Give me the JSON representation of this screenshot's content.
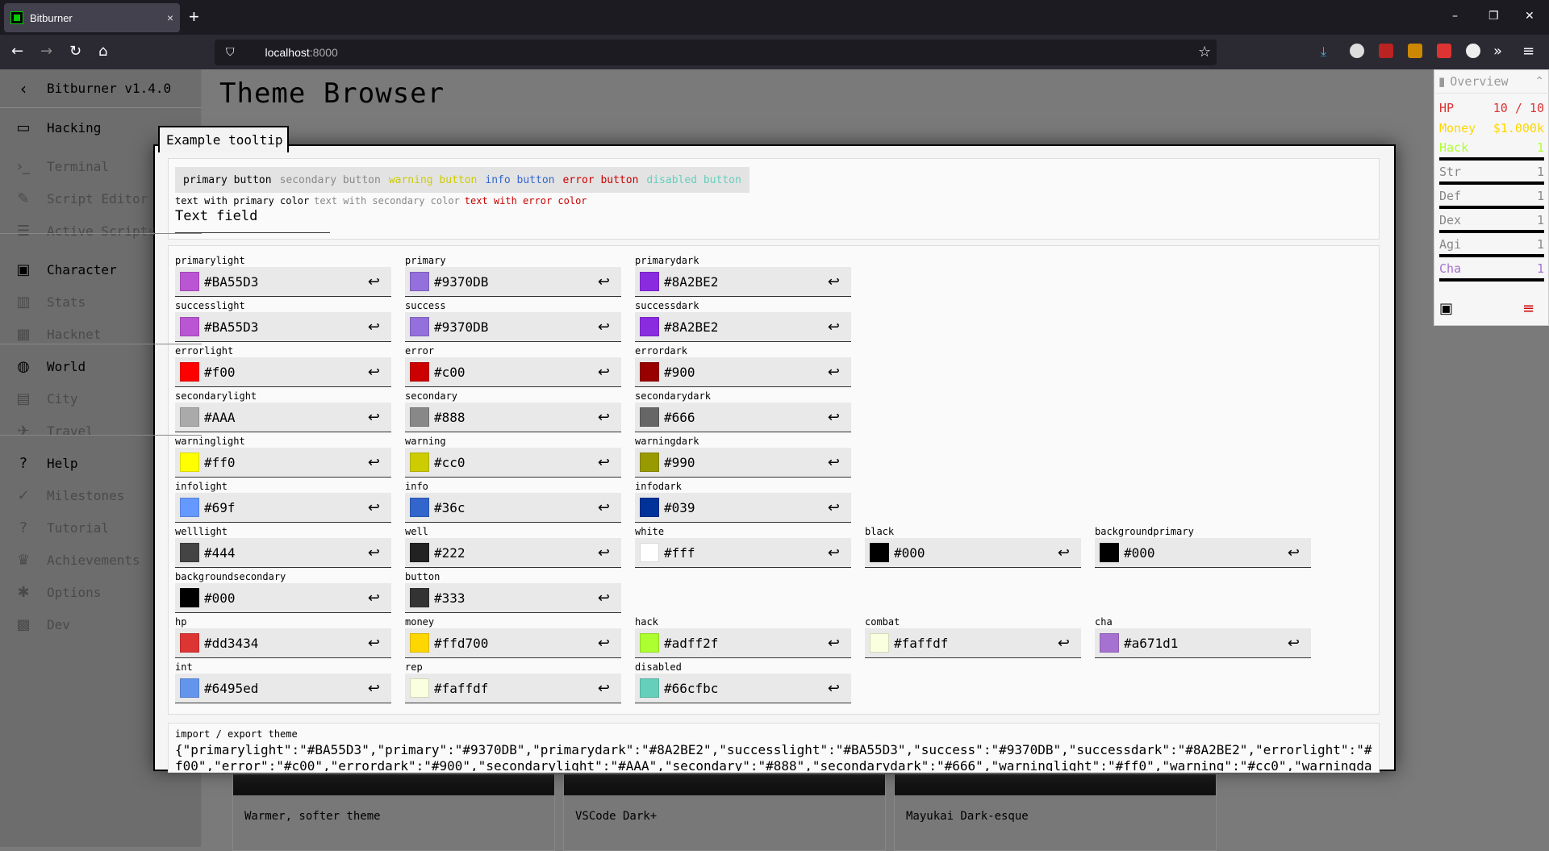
{
  "browser": {
    "tab_title": "Bitburner",
    "tab_close": "×",
    "new_tab": "+",
    "url_host": "localhost",
    "url_port": ":8000",
    "win_min": "–",
    "win_restore": "❐",
    "win_close": "✕",
    "nav_back": "←",
    "nav_forward": "→",
    "nav_reload": "↻",
    "nav_home": "⌂",
    "bookmark_star": "☆",
    "overflow": "»",
    "menu": "≡"
  },
  "sidebar": {
    "title": "Bitburner v1.4.0",
    "collapse": "‹",
    "items": [
      {
        "label": "Hacking",
        "kind": "main",
        "icon": "▭"
      },
      {
        "label": "Terminal",
        "kind": "sub",
        "icon": "›_"
      },
      {
        "label": "Script Editor",
        "kind": "sub",
        "icon": "✎"
      },
      {
        "label": "Active Scripts",
        "kind": "sub",
        "icon": "☰"
      },
      {
        "label": "Character",
        "kind": "main",
        "icon": "▣"
      },
      {
        "label": "Stats",
        "kind": "sub",
        "icon": "▥"
      },
      {
        "label": "Hacknet",
        "kind": "sub",
        "icon": "▦"
      },
      {
        "label": "World",
        "kind": "main",
        "icon": "◍"
      },
      {
        "label": "City",
        "kind": "sub",
        "icon": "▤"
      },
      {
        "label": "Travel",
        "kind": "sub",
        "icon": "✈"
      },
      {
        "label": "Help",
        "kind": "main",
        "icon": "?"
      },
      {
        "label": "Milestones",
        "kind": "sub",
        "icon": "✓"
      },
      {
        "label": "Tutorial",
        "kind": "sub",
        "icon": "?"
      },
      {
        "label": "Achievements",
        "kind": "sub",
        "icon": "♛"
      },
      {
        "label": "Options",
        "kind": "sub",
        "icon": "✱"
      },
      {
        "label": "Dev",
        "kind": "sub",
        "icon": "▩"
      }
    ]
  },
  "page": {
    "title": "Theme Browser",
    "cards": [
      "Warmer, softer theme",
      "VSCode Dark+",
      "Mayukai Dark-esque"
    ]
  },
  "overview": {
    "title": "Overview",
    "rows": [
      {
        "label": "HP",
        "value": "10 / 10",
        "color": "#dd3434",
        "bar": false
      },
      {
        "label": "Money",
        "value": "$1.000k",
        "color": "#ffd700",
        "bar": false
      },
      {
        "label": "Hack",
        "value": "1",
        "color": "#adff2f",
        "bar": true
      },
      {
        "label": "Str",
        "value": "1",
        "color": "#888888",
        "bar": true
      },
      {
        "label": "Def",
        "value": "1",
        "color": "#888888",
        "bar": true
      },
      {
        "label": "Dex",
        "value": "1",
        "color": "#888888",
        "bar": true
      },
      {
        "label": "Agi",
        "value": "1",
        "color": "#888888",
        "bar": true
      },
      {
        "label": "Cha",
        "value": "1",
        "color": "#a671d1",
        "bar": true
      }
    ]
  },
  "tooltip": "Example tooltip",
  "preview": {
    "buttons": [
      {
        "label": "primary button",
        "color": "#000000"
      },
      {
        "label": "secondary button",
        "color": "#888888"
      },
      {
        "label": "warning button",
        "color": "#cccc00"
      },
      {
        "label": "info button",
        "color": "#3366cc"
      },
      {
        "label": "error button",
        "color": "#cc0000"
      },
      {
        "label": "disabled button",
        "color": "#66cfbc"
      }
    ],
    "texts": [
      {
        "label": "text with primary color",
        "color": "#000000"
      },
      {
        "label": "text with secondary color",
        "color": "#888888"
      },
      {
        "label": "text with error color",
        "color": "#cc0000"
      }
    ],
    "text_field": "Text field"
  },
  "colors": [
    {
      "name": "primarylight",
      "value": "#BA55D3",
      "col": 0,
      "row": 0
    },
    {
      "name": "primary",
      "value": "#9370DB",
      "col": 1,
      "row": 0
    },
    {
      "name": "primarydark",
      "value": "#8A2BE2",
      "col": 2,
      "row": 0
    },
    {
      "name": "successlight",
      "value": "#BA55D3",
      "col": 0,
      "row": 1
    },
    {
      "name": "success",
      "value": "#9370DB",
      "col": 1,
      "row": 1
    },
    {
      "name": "successdark",
      "value": "#8A2BE2",
      "col": 2,
      "row": 1
    },
    {
      "name": "errorlight",
      "value": "#f00",
      "col": 0,
      "row": 2
    },
    {
      "name": "error",
      "value": "#c00",
      "col": 1,
      "row": 2
    },
    {
      "name": "errordark",
      "value": "#900",
      "col": 2,
      "row": 2
    },
    {
      "name": "secondarylight",
      "value": "#AAA",
      "col": 0,
      "row": 3
    },
    {
      "name": "secondary",
      "value": "#888",
      "col": 1,
      "row": 3
    },
    {
      "name": "secondarydark",
      "value": "#666",
      "col": 2,
      "row": 3
    },
    {
      "name": "warninglight",
      "value": "#ff0",
      "col": 0,
      "row": 4
    },
    {
      "name": "warning",
      "value": "#cc0",
      "col": 1,
      "row": 4
    },
    {
      "name": "warningdark",
      "value": "#990",
      "col": 2,
      "row": 4
    },
    {
      "name": "infolight",
      "value": "#69f",
      "col": 0,
      "row": 5
    },
    {
      "name": "info",
      "value": "#36c",
      "col": 1,
      "row": 5
    },
    {
      "name": "infodark",
      "value": "#039",
      "col": 2,
      "row": 5
    },
    {
      "name": "welllight",
      "value": "#444",
      "col": 0,
      "row": 6
    },
    {
      "name": "well",
      "value": "#222",
      "col": 1,
      "row": 6
    },
    {
      "name": "white",
      "value": "#fff",
      "col": 2,
      "row": 6
    },
    {
      "name": "black",
      "value": "#000",
      "col": 3,
      "row": 6
    },
    {
      "name": "backgroundprimary",
      "value": "#000",
      "col": 4,
      "row": 6
    },
    {
      "name": "backgroundsecondary",
      "value": "#000",
      "col": 0,
      "row": 7
    },
    {
      "name": "button",
      "value": "#333",
      "col": 1,
      "row": 7
    },
    {
      "name": "hp",
      "value": "#dd3434",
      "col": 0,
      "row": 8
    },
    {
      "name": "money",
      "value": "#ffd700",
      "col": 1,
      "row": 8
    },
    {
      "name": "hack",
      "value": "#adff2f",
      "col": 2,
      "row": 8
    },
    {
      "name": "combat",
      "value": "#faffdf",
      "col": 3,
      "row": 8
    },
    {
      "name": "cha",
      "value": "#a671d1",
      "col": 4,
      "row": 8
    },
    {
      "name": "int",
      "value": "#6495ed",
      "col": 0,
      "row": 9
    },
    {
      "name": "rep",
      "value": "#faffdf",
      "col": 1,
      "row": 9
    },
    {
      "name": "disabled",
      "value": "#66cfbc",
      "col": 2,
      "row": 9
    }
  ],
  "export": {
    "label": "import / export theme",
    "text": "{\"primarylight\":\"#BA55D3\",\"primary\":\"#9370DB\",\"primarydark\":\"#8A2BE2\",\"successlight\":\"#BA55D3\",\"success\":\"#9370DB\",\"successdark\":\"#8A2BE2\",\"errorlight\":\"#f00\",\"error\":\"#c00\",\"errordark\":\"#900\",\"secondarylight\":\"#AAA\",\"secondary\":\"#888\",\"secondarydark\":\"#666\",\"warninglight\":\"#ff0\",\"warning\":\"#cc0\",\"warningda"
  },
  "reset_icon": "↩"
}
